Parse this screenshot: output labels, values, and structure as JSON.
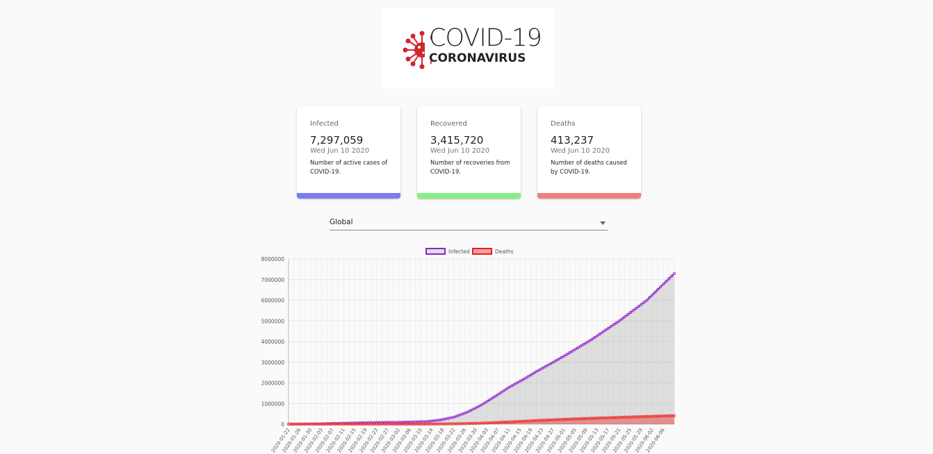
{
  "logo": {
    "line1": "COVID-19",
    "line2": "CORONAVIRUS",
    "accent": "#d0262d"
  },
  "cards": [
    {
      "title": "Infected",
      "value": "7,297,059",
      "date": "Wed Jun 10 2020",
      "desc": "Number of active cases of COVID-19.",
      "color": "#7c7cf0"
    },
    {
      "title": "Recovered",
      "value": "3,415,720",
      "date": "Wed Jun 10 2020",
      "desc": "Number of recoveries from COVID-19.",
      "color": "#86ee86"
    },
    {
      "title": "Deaths",
      "value": "413,237",
      "date": "Wed Jun 10 2020",
      "desc": "Number of deaths caused by COVID-19.",
      "color": "#f08080"
    }
  ],
  "country_select": {
    "value": "Global"
  },
  "chart_data": {
    "type": "line",
    "ylim": [
      0,
      8000000
    ],
    "yticks": [
      "0",
      "1000000",
      "2000000",
      "3000000",
      "4000000",
      "5000000",
      "6000000",
      "7000000",
      "8000000"
    ],
    "xticks": [
      "2020-01-22",
      "2020-01-26",
      "2020-01-30",
      "2020-02-03",
      "2020-02-07",
      "2020-02-11",
      "2020-02-15",
      "2020-02-19",
      "2020-02-23",
      "2020-02-27",
      "2020-03-02",
      "2020-03-06",
      "2020-03-10",
      "2020-03-14",
      "2020-03-18",
      "2020-03-22",
      "2020-03-26",
      "2020-03-30",
      "2020-04-03",
      "2020-04-07",
      "2020-04-11",
      "2020-04-15",
      "2020-04-19",
      "2020-04-23",
      "2020-04-27",
      "2020-05-01",
      "2020-05-05",
      "2020-05-09",
      "2020-05-13",
      "2020-05-17",
      "2020-05-21",
      "2020-05-25",
      "2020-05-29",
      "2020-06-02",
      "2020-06-06"
    ],
    "grid": true,
    "legend_position": "top",
    "series": [
      {
        "name": "Infected",
        "color": "#8e24c8",
        "fill": "rgba(180,180,180,0.4)",
        "x": [
          "2020-01-22",
          "2020-02-01",
          "2020-02-11",
          "2020-02-21",
          "2020-03-02",
          "2020-03-12",
          "2020-03-17",
          "2020-03-22",
          "2020-03-27",
          "2020-04-01",
          "2020-04-06",
          "2020-04-11",
          "2020-04-16",
          "2020-04-21",
          "2020-04-26",
          "2020-05-01",
          "2020-05-06",
          "2020-05-11",
          "2020-05-16",
          "2020-05-21",
          "2020-05-26",
          "2020-05-31",
          "2020-06-05",
          "2020-06-10"
        ],
        "values": [
          555,
          12000,
          43000,
          77000,
          90000,
          126000,
          200000,
          340000,
          590000,
          930000,
          1350000,
          1780000,
          2150000,
          2550000,
          2920000,
          3300000,
          3700000,
          4100000,
          4550000,
          5000000,
          5500000,
          6000000,
          6650000,
          7297059
        ]
      },
      {
        "name": "Deaths",
        "color": "#e81c1c",
        "fill": "rgba(232,28,28,0.4)",
        "x": [
          "2020-01-22",
          "2020-02-11",
          "2020-03-02",
          "2020-03-12",
          "2020-03-22",
          "2020-04-01",
          "2020-04-11",
          "2020-04-21",
          "2020-05-01",
          "2020-05-11",
          "2020-05-21",
          "2020-05-31",
          "2020-06-10"
        ],
        "values": [
          17,
          1100,
          3100,
          4600,
          14000,
          47000,
          108000,
          175000,
          234000,
          285000,
          330000,
          372000,
          413237
        ]
      }
    ]
  }
}
